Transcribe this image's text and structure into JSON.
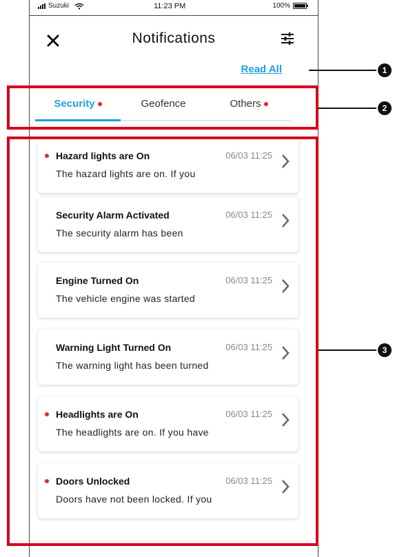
{
  "status_bar": {
    "carrier": "Suzuki",
    "time": "11:23 PM",
    "battery": "100%"
  },
  "header": {
    "title": "Notifications",
    "close_icon": "close-icon",
    "filter_icon": "sliders-icon"
  },
  "read_all": "Read All",
  "tabs": [
    {
      "label": "Security",
      "unread": true,
      "active": true
    },
    {
      "label": "Geofence",
      "unread": false,
      "active": false
    },
    {
      "label": "Others",
      "unread": true,
      "active": false
    }
  ],
  "notifications": [
    {
      "title": "Hazard lights are On",
      "time": "06/03 11:25",
      "body": "The hazard lights are on. If you",
      "unread": true
    },
    {
      "title": "Security Alarm Activated",
      "time": "06/03 11:25",
      "body": "The security alarm has been",
      "unread": false
    },
    {
      "title": "Engine Turned On",
      "time": "06/03 11:25",
      "body": "The vehicle engine was started",
      "unread": false
    },
    {
      "title": "Warning Light Turned On",
      "time": "06/03 11:25",
      "body": "The warning light has been turned",
      "unread": false
    },
    {
      "title": "Headlights are On",
      "time": "06/03 11:25",
      "body": "The headlights are on. If you have",
      "unread": true
    },
    {
      "title": "Doors Unlocked",
      "time": "06/03 11:25",
      "body": "Doors have not been locked. If you",
      "unread": true
    }
  ],
  "callouts": [
    "1",
    "2",
    "3"
  ],
  "colors": {
    "accent": "#1ea0e0",
    "unread_dot": "#e8262b",
    "callout_frame": "#d6001c"
  }
}
